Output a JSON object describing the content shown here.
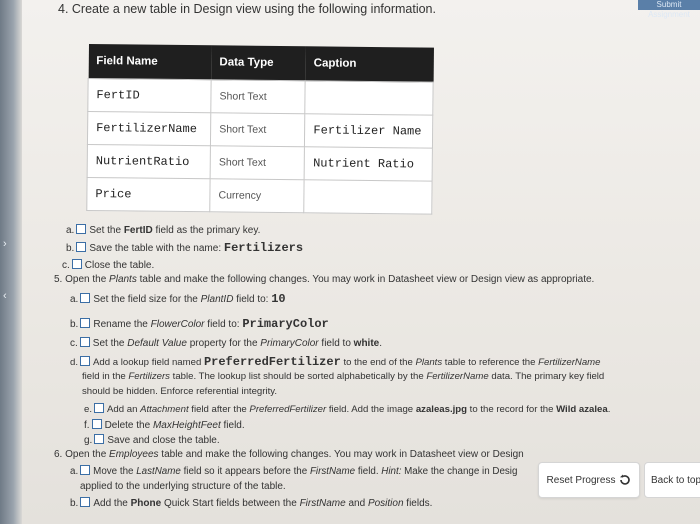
{
  "corner_tag": "Submit Assignment",
  "heading": "4. Create a new table in Design view using the following information.",
  "table": {
    "headers": [
      "Field Name",
      "Data Type",
      "Caption"
    ],
    "rows": [
      {
        "field": "FertID",
        "type": "Short Text",
        "caption": ""
      },
      {
        "field": "FertilizerName",
        "type": "Short Text",
        "caption": "Fertilizer Name"
      },
      {
        "field": "NutrientRatio",
        "type": "Short Text",
        "caption": "Nutrient Ratio"
      },
      {
        "field": "Price",
        "type": "Currency",
        "caption": ""
      }
    ]
  },
  "q4": {
    "a": {
      "prefix": "a.",
      "t1": "Set the ",
      "b1": "FertID",
      "t2": " field as the primary key."
    },
    "b": {
      "prefix": "b.",
      "t1": "Save the table with the name: ",
      "code": "Fertilizers"
    },
    "c": {
      "prefix": "c.",
      "t1": "Close the table."
    }
  },
  "q5": {
    "heading": {
      "t1": "5. Open the ",
      "i1": "Plants",
      "t2": " table and make the following changes. You may work in Datasheet view or Design view as appropriate."
    },
    "a": {
      "prefix": "a.",
      "t1": "Set the field size for the ",
      "i1": "PlantID",
      "t2": " field to: ",
      "code": "10"
    },
    "b": {
      "prefix": "b.",
      "t1": "Rename the ",
      "i1": "FlowerColor",
      "t2": " field to: ",
      "code": "PrimaryColor"
    },
    "c": {
      "prefix": "c.",
      "t1": "Set the ",
      "i1": "Default Value",
      "t2": " property for the ",
      "i2": "PrimaryColor",
      "t3": " field to ",
      "b1": "white",
      "t4": "."
    },
    "d": {
      "prefix": "d.",
      "t1": "Add a lookup field named ",
      "code": "PreferredFertilizer",
      "t2": " to the end of the ",
      "i1": "Plants",
      "t3": " table to reference the ",
      "i2": "FertilizerName",
      "l2_t1": "field in the ",
      "l2_i1": "Fertilizers",
      "l2_t2": " table. The lookup list should be sorted alphabetically by the ",
      "l2_i2": "FertilizerName",
      "l2_t3": " data. The primary key field",
      "l3": "should be hidden. Enforce referential integrity."
    },
    "e": {
      "prefix": "e.",
      "t1": "Add an ",
      "i1": "Attachment",
      "t2": " field after the ",
      "i2": "PreferredFertilizer",
      "t3": " field. Add the image ",
      "b1": "azaleas.jpg",
      "t4": " to the record for the ",
      "b2": "Wild azalea",
      "t5": "."
    },
    "f": {
      "prefix": "f.",
      "t1": "Delete the ",
      "i1": "MaxHeightFeet",
      "t2": " field."
    },
    "g": {
      "prefix": "g.",
      "t1": "Save and close the table."
    }
  },
  "q6": {
    "heading": {
      "t1": "6. Open the ",
      "i1": "Employees",
      "t2": " table and make the following changes. You may work in Datasheet view or Design"
    },
    "a": {
      "prefix": "a.",
      "t1": "Move the ",
      "i1": "LastName",
      "t2": " field so it appears before the ",
      "i2": "FirstName",
      "t3": " field. ",
      "i3": "Hint:",
      "t4": " Make the change in Desig",
      "l2": "applied to the underlying structure of the table."
    },
    "b": {
      "prefix": "b.",
      "t1": "Add the ",
      "b1": "Phone",
      "t2": " Quick Start fields between the ",
      "i1": "FirstName",
      "t3": " and ",
      "i2": "Position",
      "t4": " fields."
    }
  },
  "buttons": {
    "reset": "Reset Progress",
    "back": "Back to top"
  },
  "colors": {
    "checkbox_border": "#3b6ea5",
    "table_header": "#1f1f1f"
  }
}
